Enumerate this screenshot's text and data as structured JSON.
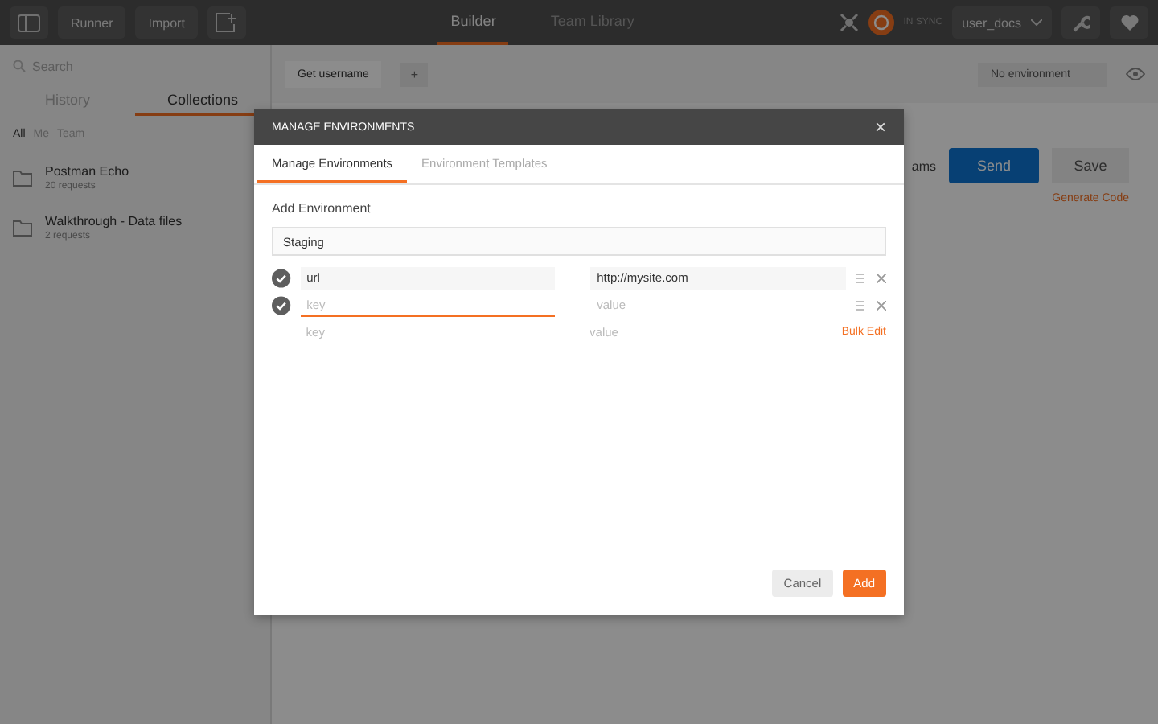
{
  "header": {
    "buttons": [
      "Runner",
      "Import"
    ],
    "tabs": [
      {
        "label": "Builder",
        "selected": true
      },
      {
        "label": "Team Library",
        "selected": false
      }
    ],
    "sync": "IN SYNC",
    "workspace": "user_docs"
  },
  "sidebar": {
    "search": {
      "placeholder": "Search"
    },
    "tabs": [
      {
        "label": "History",
        "selected": false
      },
      {
        "label": "Collections",
        "selected": true
      }
    ],
    "filters": [
      {
        "label": "All",
        "selected": true
      },
      {
        "label": "Me",
        "selected": false
      },
      {
        "label": "Team",
        "selected": false
      }
    ],
    "collections": [
      {
        "name": "Postman Echo",
        "count": "20 requests"
      },
      {
        "name": "Walkthrough - Data files",
        "count": "2 requests"
      }
    ]
  },
  "main": {
    "request_tab": "Get username",
    "add_tab": "+",
    "environment": "No environment",
    "params": "ams",
    "send": "Send",
    "save": "Save",
    "generate_code": "Generate Code"
  },
  "modal": {
    "title": "MANAGE ENVIRONMENTS",
    "close": "×",
    "tabs": [
      {
        "label": "Manage Environments",
        "selected": true
      },
      {
        "label": "Environment Templates",
        "selected": false
      }
    ],
    "section_label": "Add Environment",
    "name_value": "Staging",
    "rows": [
      {
        "key": "url",
        "value": "http://mysite.com",
        "checked": true,
        "focused": false
      },
      {
        "key_placeholder": "key",
        "value_placeholder": "value",
        "checked": true,
        "focused": true
      }
    ],
    "new_row": {
      "key_placeholder": "key",
      "value_placeholder": "value",
      "bulk_edit": "Bulk Edit"
    },
    "buttons": [
      {
        "label": "Cancel",
        "kind": "secondary"
      },
      {
        "label": "Add",
        "kind": "primary"
      }
    ]
  }
}
